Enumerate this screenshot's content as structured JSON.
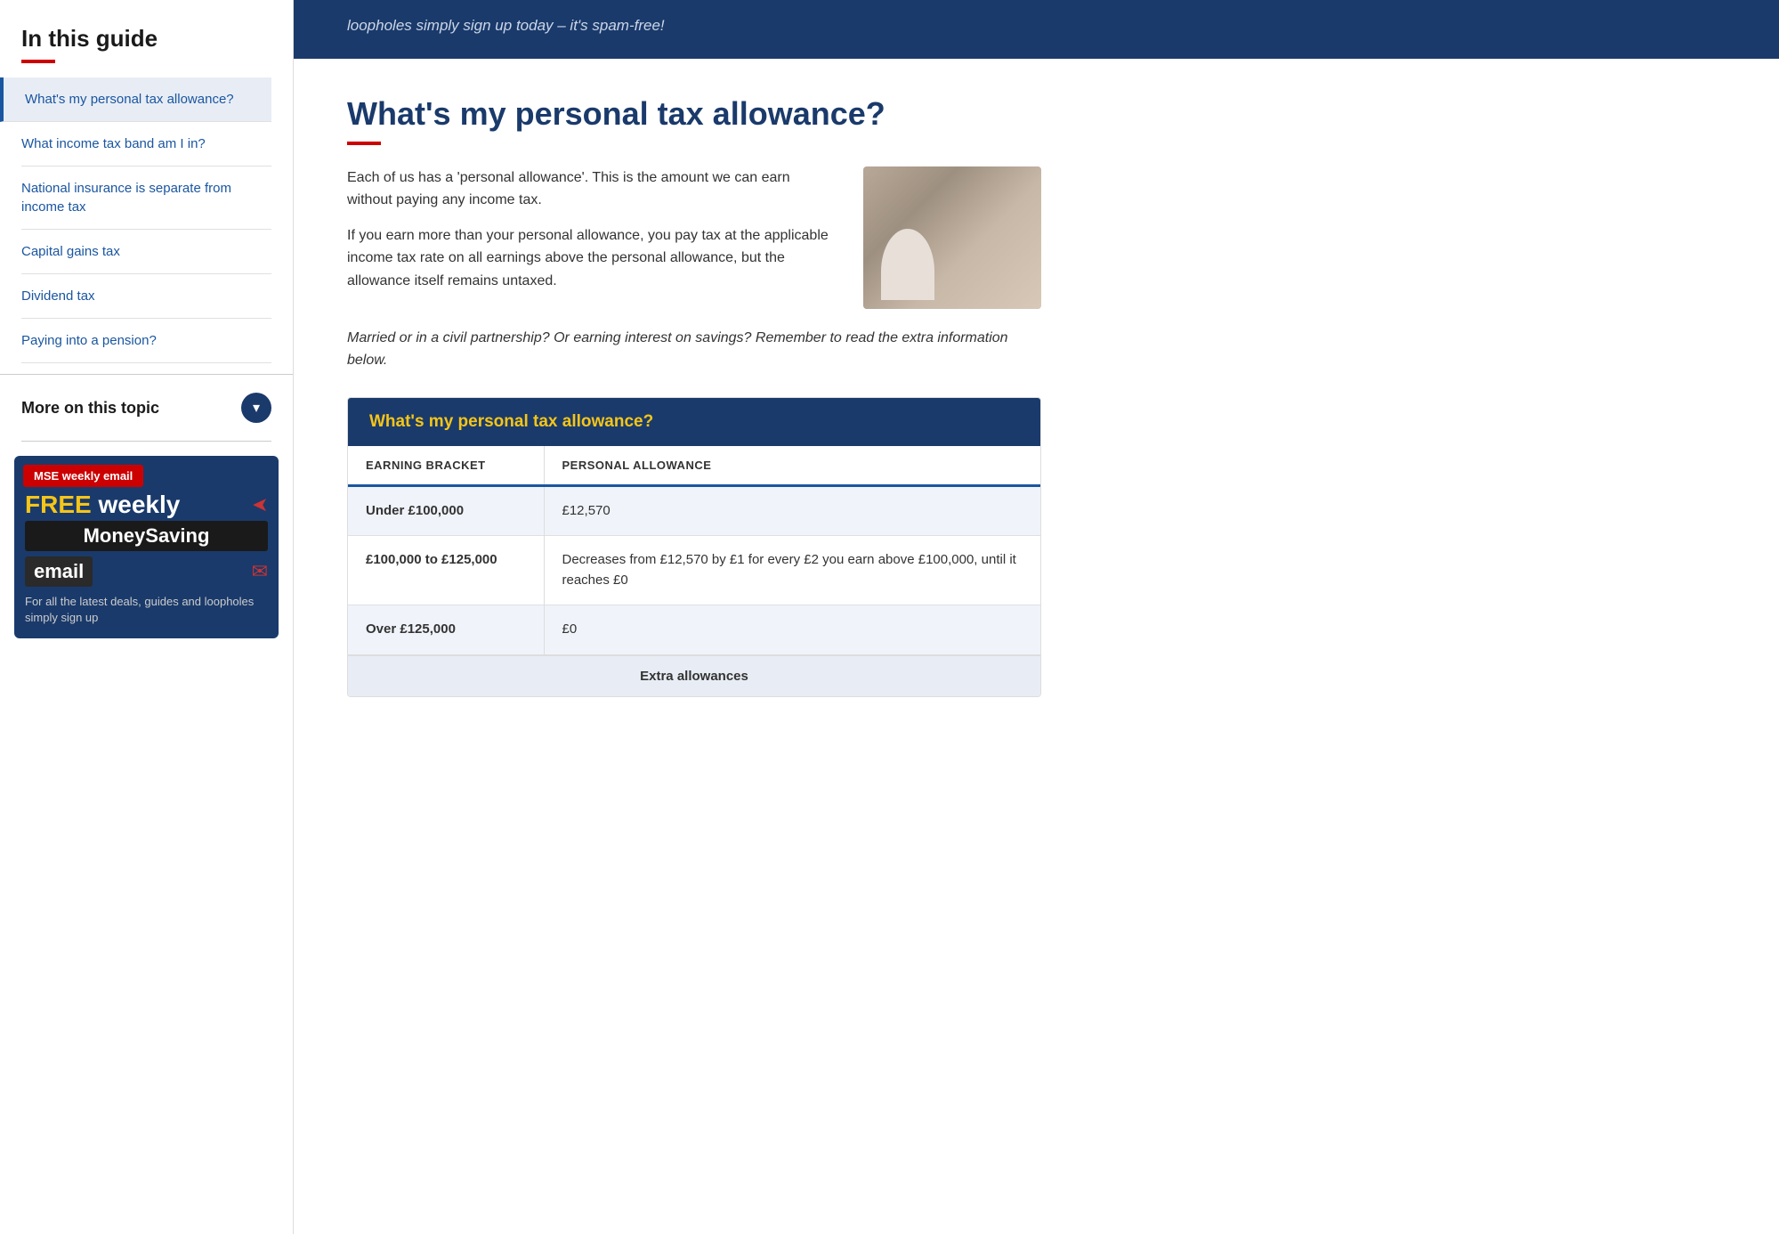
{
  "sidebar": {
    "guide_title": "In this guide",
    "nav_items": [
      {
        "label": "What's my personal tax allowance?",
        "active": true
      },
      {
        "label": "What income tax band am I in?",
        "active": false
      },
      {
        "label": "National insurance is separate from income tax",
        "active": false
      },
      {
        "label": "Capital gains tax",
        "active": false
      },
      {
        "label": "Dividend tax",
        "active": false
      },
      {
        "label": "Paying into a pension?",
        "active": false
      }
    ],
    "more_on_topic": "More on this topic",
    "email_badge": "MSE weekly email",
    "email_free": "FREE",
    "email_weekly": " weekly",
    "email_moneysaving": "MoneySaving",
    "email_label": "email",
    "email_footer": "For all the latest deals, guides and loopholes simply sign up"
  },
  "banner": {
    "text": "loopholes simply sign up today – it's spam-free!"
  },
  "article": {
    "title": "What's my personal tax allowance?",
    "intro1": "Each of us has a 'personal allowance'. This is the amount we can earn without paying any income tax.",
    "intro2": "If you earn more than your personal allowance, you pay tax at the applicable income tax rate on all earnings above the personal allowance, but the allowance itself remains untaxed.",
    "italic_note": "Married or in a civil partnership? Or earning interest on savings? Remember to read the extra information below.",
    "table": {
      "header_title_prefix": "What's my ",
      "header_title_highlight": "personal tax allowance",
      "header_title_suffix": "?",
      "col1_header": "EARNING BRACKET",
      "col2_header": "PERSONAL ALLOWANCE",
      "rows": [
        {
          "bracket": "Under £100,000",
          "allowance": "£12,570"
        },
        {
          "bracket": "£100,000 to £125,000",
          "allowance": "Decreases from £12,570 by £1 for every £2 you earn above £100,000, until it reaches £0"
        },
        {
          "bracket": "Over £125,000",
          "allowance": "£0"
        }
      ],
      "footer": "Extra allowances"
    }
  }
}
